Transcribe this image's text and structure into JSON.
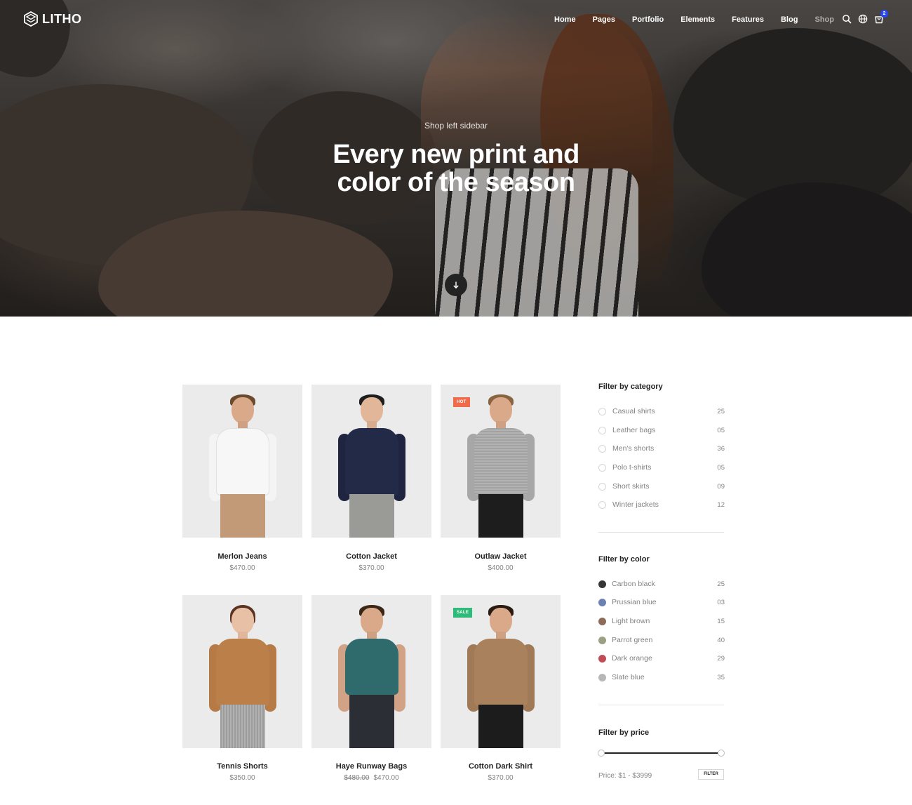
{
  "brand": {
    "name": "LITHO"
  },
  "nav": {
    "items": [
      "Home",
      "Pages",
      "Portfolio",
      "Elements",
      "Features",
      "Blog",
      "Shop"
    ],
    "icons": [
      "search-icon",
      "globe-icon",
      "cart-icon"
    ],
    "cart_count": "2"
  },
  "hero": {
    "subtitle": "Shop left sidebar",
    "title_line1": "Every new print and",
    "title_line2": "color of the season"
  },
  "products": [
    {
      "name": "Merlon Jeans",
      "price": "$470.00",
      "old_price": "",
      "badge": ""
    },
    {
      "name": "Cotton Jacket",
      "price": "$370.00",
      "old_price": "",
      "badge": ""
    },
    {
      "name": "Outlaw Jacket",
      "price": "$400.00",
      "old_price": "",
      "badge": "HOT"
    },
    {
      "name": "Tennis Shorts",
      "price": "$350.00",
      "old_price": "",
      "badge": ""
    },
    {
      "name": "Haye Runway Bags",
      "price": "$470.00",
      "old_price": "$480.00",
      "badge": ""
    },
    {
      "name": "Cotton Dark Shirt",
      "price": "$370.00",
      "old_price": "",
      "badge": "SALE"
    }
  ],
  "filters": {
    "category": {
      "heading": "Filter by category",
      "items": [
        {
          "label": "Casual shirts",
          "count": "25"
        },
        {
          "label": "Leather bags",
          "count": "05"
        },
        {
          "label": "Men's shorts",
          "count": "36"
        },
        {
          "label": "Polo t-shirts",
          "count": "05"
        },
        {
          "label": "Short skirts",
          "count": "09"
        },
        {
          "label": "Winter jackets",
          "count": "12"
        }
      ]
    },
    "color": {
      "heading": "Filter by color",
      "items": [
        {
          "label": "Carbon black",
          "count": "25",
          "color": "#363636"
        },
        {
          "label": "Prussian blue",
          "count": "03",
          "color": "#6b80b3"
        },
        {
          "label": "Light brown",
          "count": "15",
          "color": "#8d6c58"
        },
        {
          "label": "Parrot green",
          "count": "40",
          "color": "#9aa083"
        },
        {
          "label": "Dark orange",
          "count": "29",
          "color": "#c24c55"
        },
        {
          "label": "Slate blue",
          "count": "35",
          "color": "#b7b7b7"
        }
      ]
    },
    "price": {
      "heading": "Filter by price",
      "range_text": "Price: $1 - $3999",
      "button": "FILTER"
    }
  },
  "colors": {
    "badge_hot": "#ef6b4c",
    "badge_sale": "#2ebb79",
    "cart_badge": "#2946f3"
  }
}
